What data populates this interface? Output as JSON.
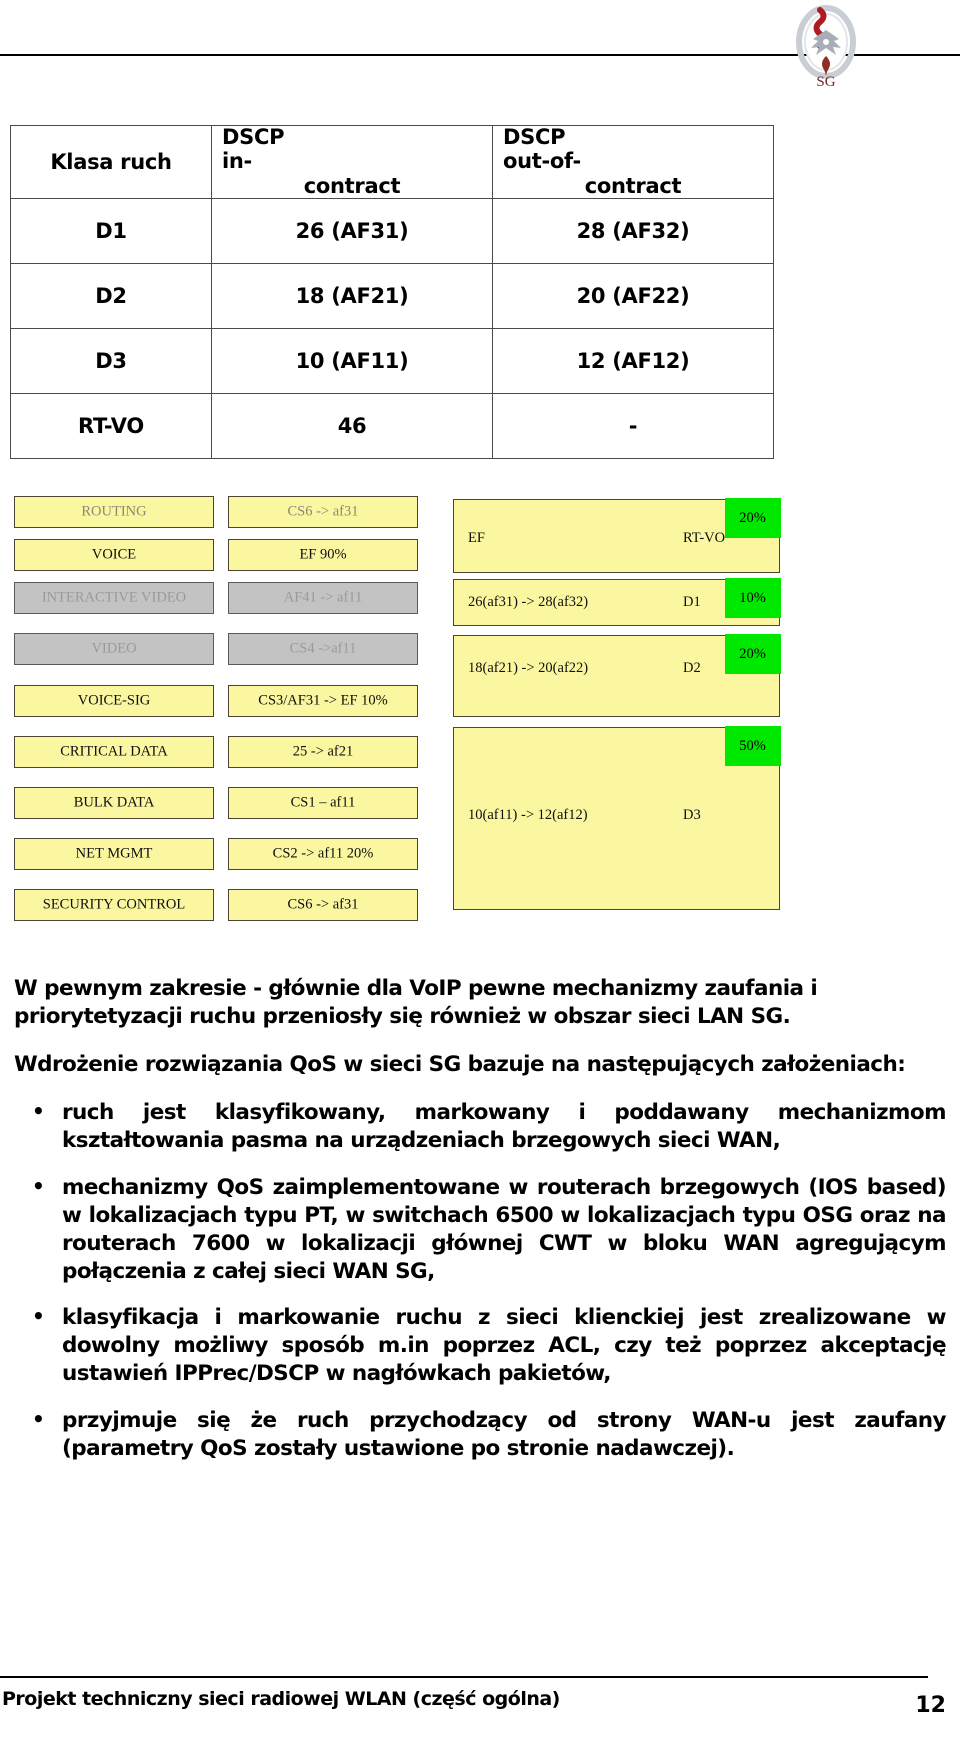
{
  "header": {
    "logo_name": "polish-emblem-logo"
  },
  "dscp_table": {
    "columns": [
      "Klasa ruch",
      "DSCP in-contract",
      "DSCP out-of-contract"
    ],
    "columns_display": [
      "Klasa ruch",
      [
        "DSCP",
        "in-",
        "contract"
      ],
      [
        "DSCP",
        "out-of-",
        "contract"
      ]
    ],
    "rows": [
      {
        "klasa": "D1",
        "in": "26 (AF31)",
        "out": "28 (AF32)"
      },
      {
        "klasa": "D2",
        "in": "18 (AF21)",
        "out": "20 (AF22)"
      },
      {
        "klasa": "D3",
        "in": "10 (AF11)",
        "out": "12 (AF12)"
      },
      {
        "klasa": "RT-VO",
        "in": "46",
        "out": "-"
      }
    ]
  },
  "diagram": {
    "traffic_rows": [
      {
        "name": "ROUTING",
        "mapping": "CS6 -> af31",
        "state": "faded"
      },
      {
        "name": "VOICE",
        "mapping": "EF 90%",
        "state": "normal"
      },
      {
        "name": "INTERACTIVE VIDEO",
        "mapping": "AF41 -> af11",
        "state": "disabled"
      },
      {
        "name": "VIDEO",
        "mapping": "CS4 ->af11",
        "state": "disabled"
      },
      {
        "name": "VOICE-SIG",
        "mapping": "CS3/AF31 -> EF 10%",
        "state": "normal"
      },
      {
        "name": "CRITICAL DATA",
        "mapping": "25 -> af21",
        "state": "normal"
      },
      {
        "name": "BULK DATA",
        "mapping": "CS1 – af11",
        "state": "normal"
      },
      {
        "name": "NET MGMT",
        "mapping": "CS2 -> af11 20%",
        "state": "normal"
      },
      {
        "name": "SECURITY CONTROL",
        "mapping": "CS6 -> af31",
        "state": "normal"
      }
    ],
    "class_boxes": [
      {
        "mapping": "EF",
        "class": "RT-VO",
        "percent": "20%"
      },
      {
        "mapping": "26(af31) ->  28(af32)",
        "class": "D1",
        "percent": "10%"
      },
      {
        "mapping": "18(af21) -> 20(af22)",
        "class": "D2",
        "percent": "20%"
      },
      {
        "mapping": "10(af11) ->  12(af12)",
        "class": "D3",
        "percent": "50%"
      }
    ],
    "colors": {
      "box_fill": "#fbf7a0",
      "box_border": "#4d4436",
      "disabled_fill": "#c3c3c3",
      "percent_chip": "#00e800"
    }
  },
  "body": {
    "paragraphs": [
      "W pewnym zakresie - głównie dla VoIP pewne mechanizmy zaufania i priorytetyzacji ruchu przeniosły się również w obszar sieci LAN SG.",
      "Wdrożenie rozwiązania QoS w sieci SG bazuje na następujących założeniach:"
    ],
    "bullets": [
      "ruch jest klasyfikowany, markowany i poddawany mechanizmom kształtowania pasma na urządzeniach brzegowych sieci WAN,",
      "mechanizmy QoS zaimplementowane w routerach brzegowych (IOS based) w lokalizacjach typu PT, w switchach 6500 w lokalizacjach typu OSG oraz na routerach 7600 w lokalizacji głównej CWT w bloku WAN agregującym połączenia z całej sieci WAN SG,",
      "klasyfikacja i markowanie ruchu z sieci klienckiej jest zrealizowane w dowolny możliwy sposób m.in poprzez ACL, czy też poprzez akceptację ustawień IPPrec/DSCP w nagłówkach pakietów,",
      " przyjmuje się że ruch przychodzący od strony WAN-u jest zaufany (parametry QoS zostały ustawione po stronie nadawczej)."
    ]
  },
  "footer": {
    "text": "Projekt techniczny sieci radiowej WLAN  (część ogólna)",
    "page": "12"
  }
}
